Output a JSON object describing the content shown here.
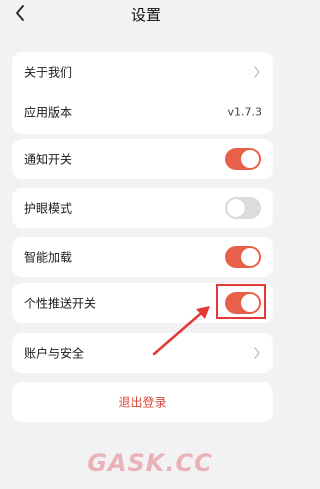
{
  "header": {
    "title": "设置",
    "back_icon": "chevron-left-icon"
  },
  "about_card": {
    "about_label": "关于我们",
    "version_label": "应用版本",
    "version_value": "v1.7.3"
  },
  "toggles": [
    {
      "label": "通知开关",
      "state": "on"
    },
    {
      "label": "护眼模式",
      "state": "off"
    },
    {
      "label": "智能加载",
      "state": "on"
    },
    {
      "label": "个性推送开关",
      "state": "on"
    }
  ],
  "account": {
    "label": "账户与安全"
  },
  "logout": {
    "label": "退出登录"
  },
  "watermark": {
    "text": "GASK.CC"
  },
  "colors": {
    "accent": "#e8604a",
    "toggle_off": "#dcdcdc",
    "logout_text": "#d9483b",
    "highlight": "#e53935"
  }
}
